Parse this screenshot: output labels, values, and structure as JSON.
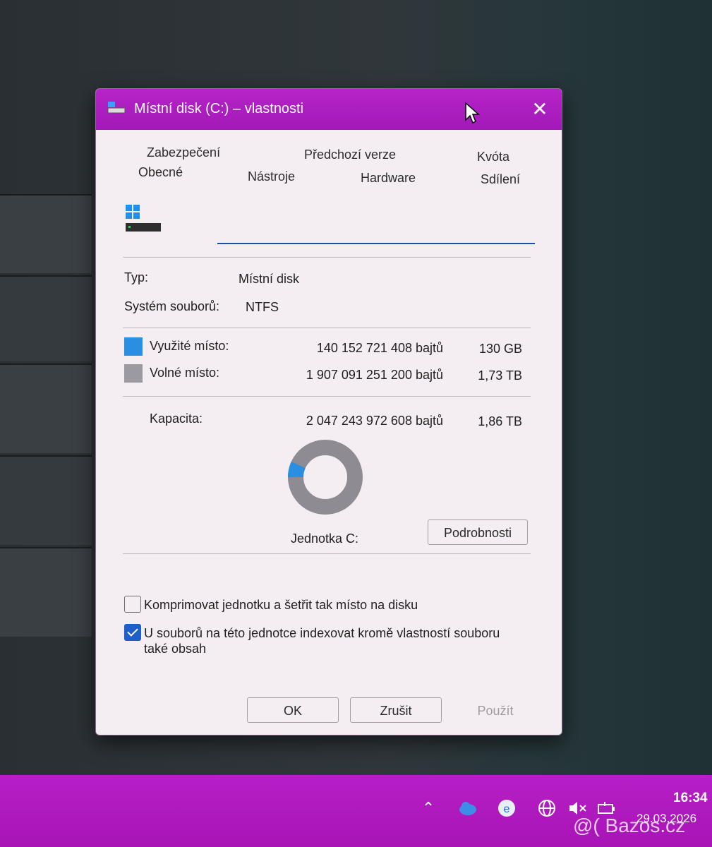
{
  "window": {
    "title": "Místní disk (C:) – vlastnosti",
    "close_label": "✕"
  },
  "tabs": [
    {
      "label": "Zabezpečení"
    },
    {
      "label": "Předchozí verze"
    },
    {
      "label": "Kvóta"
    },
    {
      "label": "Obecné"
    },
    {
      "label": "Nástroje"
    },
    {
      "label": "Hardware"
    },
    {
      "label": "Sdílení"
    }
  ],
  "name_field": {
    "value": ""
  },
  "info": {
    "type_label": "Typ:",
    "type_value": "Místní disk",
    "fs_label": "Systém souborů:",
    "fs_value": "NTFS"
  },
  "space": {
    "used_label": "Využité místo:",
    "used_bytes": "140 152 721 408 bajtů",
    "used_size": "130 GB",
    "used_color": "#2a8fe0",
    "free_label": "Volné místo:",
    "free_bytes": "1 907 091 251 200 bajtů",
    "free_size": "1,73 TB",
    "free_color": "#9b9aa0",
    "capacity_label": "Kapacita:",
    "capacity_bytes": "2 047 243 972 608 bajtů",
    "capacity_size": "1,86 TB",
    "used_fraction": 0.068
  },
  "drive_label": "Jednotka C:",
  "details_button": "Podrobnosti",
  "options": {
    "compress_label": "Komprimovat jednotku a šetřit tak místo na disku",
    "compress_checked": false,
    "index_label_line1": "U souborů na této jednotce indexovat kromě vlastností souboru",
    "index_label_line2": "také obsah",
    "index_checked": true
  },
  "buttons": {
    "ok": "OK",
    "cancel": "Zrušit",
    "apply": "Použít"
  },
  "taskbar": {
    "time": "16:34",
    "date": "29.03.2026"
  },
  "watermark": "@( Bazos.cz",
  "colors": {
    "accent": "#b524c7",
    "input_underline": "#1e4aa8"
  }
}
